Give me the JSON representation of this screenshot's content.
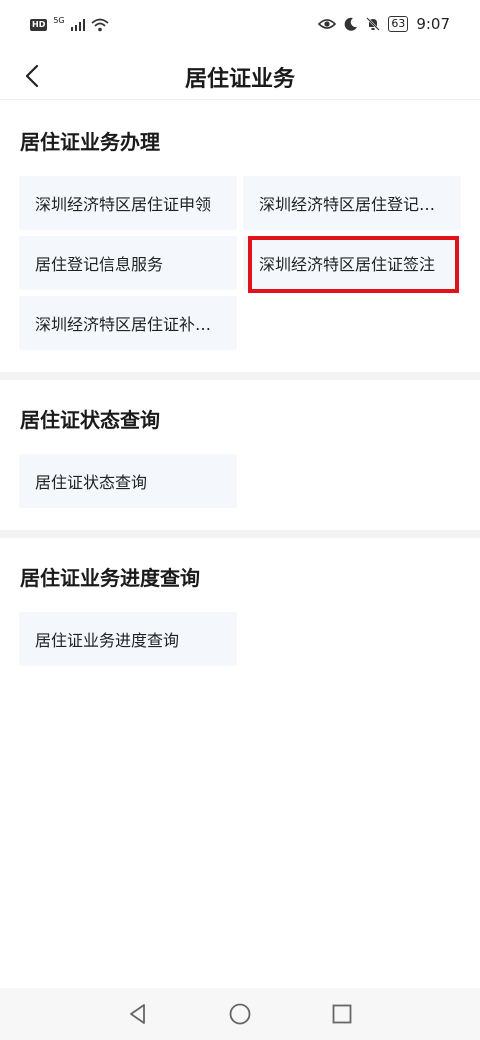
{
  "status_bar": {
    "hd": "HD",
    "network": "5G",
    "battery": "63",
    "time": "9:07",
    "icons": [
      "signal-icon",
      "wifi-icon",
      "eye-icon",
      "moon-icon",
      "bell-muted-icon"
    ]
  },
  "header": {
    "title": "居住证业务",
    "back_icon": "back-arrow-icon"
  },
  "sections": [
    {
      "title": "居住证业务办理",
      "tiles": [
        "深圳经济特区居住证申领",
        "深圳经济特区居住登记…",
        "居住登记信息服务",
        "深圳经济特区居住证签注",
        "深圳经济特区居住证补…"
      ]
    },
    {
      "title": "居住证状态查询",
      "tiles": [
        "居住证状态查询"
      ]
    },
    {
      "title": "居住证业务进度查询",
      "tiles": [
        "居住证业务进度查询"
      ]
    }
  ],
  "colors": {
    "tile_bg": "#f4f7fb",
    "highlight": "#e0121a"
  },
  "bottom_nav": [
    "back-triangle-icon",
    "home-circle-icon",
    "recents-square-icon"
  ]
}
